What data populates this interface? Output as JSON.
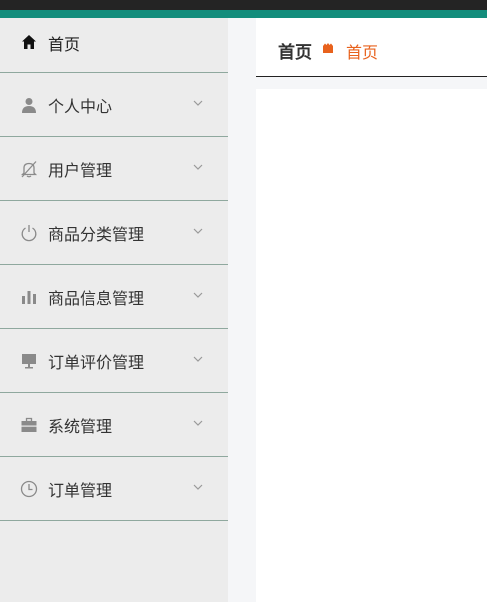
{
  "sidebar": {
    "items": [
      {
        "label": "首页",
        "icon": "home-icon"
      },
      {
        "label": "个人中心",
        "icon": "user-icon"
      },
      {
        "label": "用户管理",
        "icon": "bell-off-icon"
      },
      {
        "label": "商品分类管理",
        "icon": "power-icon"
      },
      {
        "label": "商品信息管理",
        "icon": "bar-chart-icon"
      },
      {
        "label": "订单评价管理",
        "icon": "monitor-icon"
      },
      {
        "label": "系统管理",
        "icon": "briefcase-icon"
      },
      {
        "label": "订单管理",
        "icon": "clock-icon"
      }
    ]
  },
  "breadcrumb": {
    "home": "首页",
    "current": "首页"
  },
  "colors": {
    "topbar": "#242424",
    "accent_teal": "#138d7c",
    "sidebar_bg": "#ececec",
    "divider": "#8fa89e",
    "breadcrumb_active": "#e8621d"
  }
}
